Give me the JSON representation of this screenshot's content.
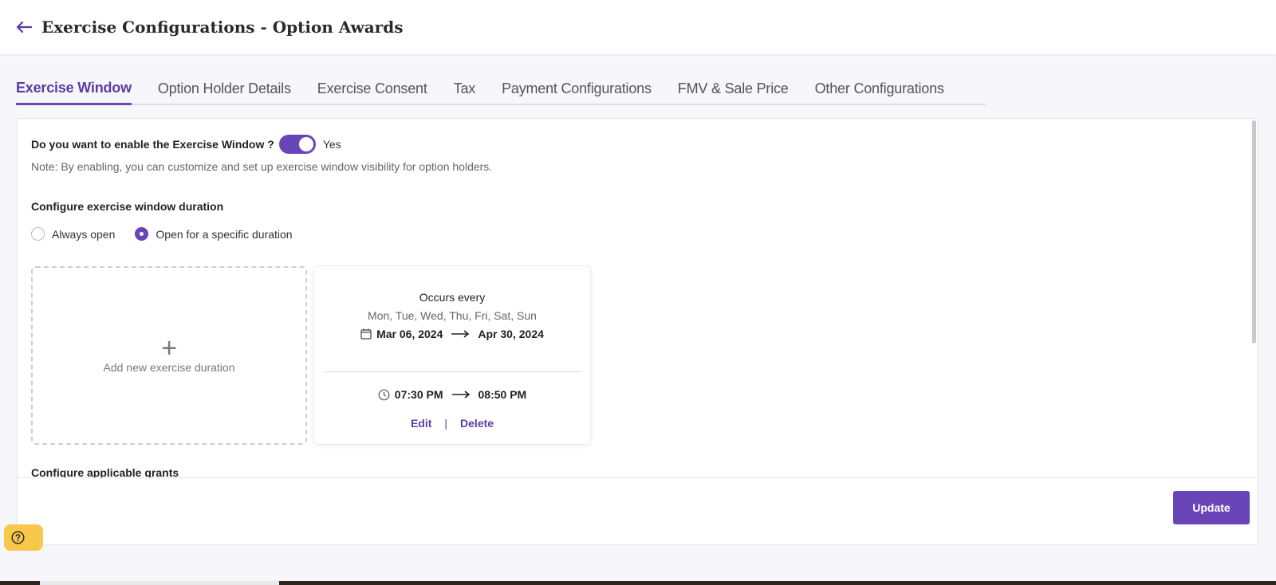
{
  "header": {
    "title": "Exercise Configurations - Option Awards",
    "back_icon": "arrow-left-icon"
  },
  "tabs": [
    {
      "label": "Exercise Window",
      "active": true
    },
    {
      "label": "Option Holder Details",
      "active": false
    },
    {
      "label": "Exercise Consent",
      "active": false
    },
    {
      "label": "Tax",
      "active": false
    },
    {
      "label": "Payment Configurations",
      "active": false
    },
    {
      "label": "FMV & Sale Price",
      "active": false
    },
    {
      "label": "Other Configurations",
      "active": false
    }
  ],
  "exercise_window": {
    "enable_question": "Do you want to enable the Exercise Window ?",
    "toggle_value": "Yes",
    "note": "Note: By enabling, you can customize and set up exercise window visibility for option holders.",
    "duration_title": "Configure exercise window duration",
    "radio_options": [
      {
        "label": "Always open",
        "selected": false
      },
      {
        "label": "Open for a specific duration",
        "selected": true
      }
    ],
    "add_label": "Add new exercise duration",
    "add_symbol": "+",
    "duration_card": {
      "occurs_label": "Occurs every",
      "days": "Mon, Tue, Wed, Thu, Fri, Sat, Sun",
      "start_date": "Mar 06, 2024",
      "end_date": "Apr 30, 2024",
      "start_time": "07:30 PM",
      "end_time": "08:50 PM",
      "edit_label": "Edit",
      "separator": "|",
      "delete_label": "Delete"
    },
    "clipped_section_title": "Configure applicable grants"
  },
  "footer": {
    "update_label": "Update"
  },
  "colors": {
    "accent": "#6a45b8",
    "help_button": "#f7c84a"
  }
}
